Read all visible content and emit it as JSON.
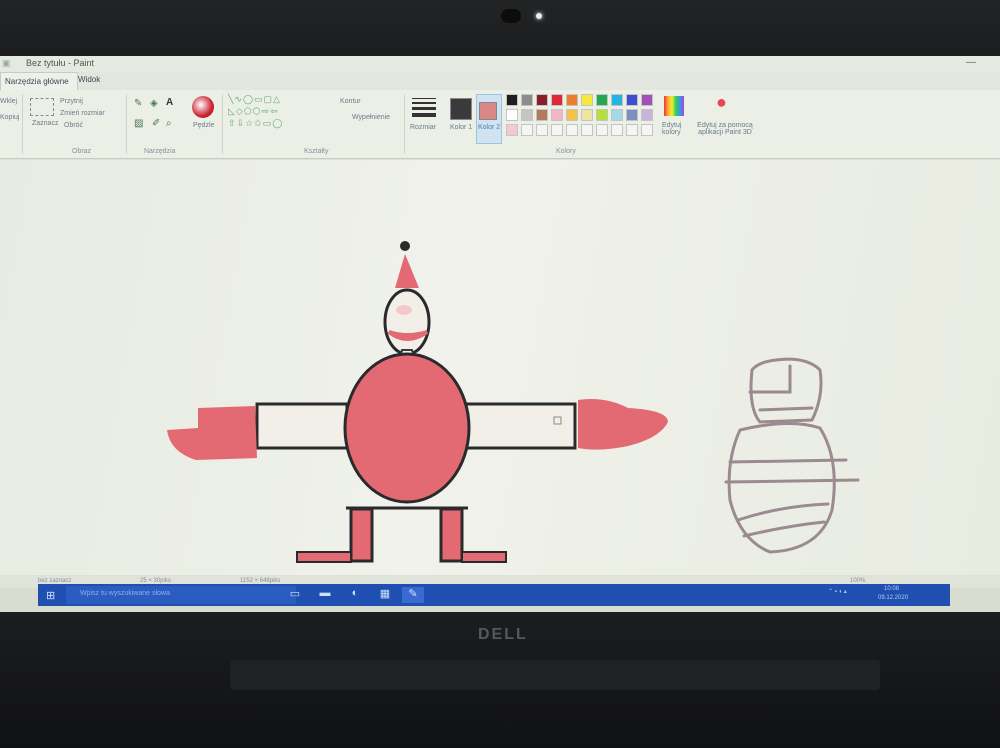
{
  "window": {
    "title": "Bez tytułu - Paint"
  },
  "tabs": [
    {
      "label": "Narzędzia główne"
    },
    {
      "label": "Widok"
    }
  ],
  "ribbon": {
    "clipboard": {
      "paste": "Wklej",
      "cut": "Wytnij",
      "copy": "Kopiuj"
    },
    "image": {
      "select": "Zaznacz",
      "crop": "Przytnij",
      "resize": "Zmień rozmiar",
      "rotate": "Obróć",
      "group": "Obraz"
    },
    "tools": {
      "group": "Narzędzia",
      "brushes": "Pędzle"
    },
    "shapes": {
      "group": "Kształty",
      "outline": "Kontur",
      "fill": "Wypełnienie"
    },
    "size": "Rozmiar",
    "colors": {
      "group": "Kolory",
      "color1": "Kolor 1",
      "color2": "Kolor 2",
      "color1_value": "#3a3a3d",
      "color2_value": "#d98686",
      "edit": "Edytuj kolory",
      "paint3d": "Edytuj za pomocą aplikacji Paint 3D",
      "palette_row1": [
        "#1f1f22",
        "#8c8c8c",
        "#8b1e2c",
        "#e0273a",
        "#ef7b2c",
        "#f7e93a",
        "#23a84f",
        "#23b4e6",
        "#3c4fd1",
        "#a24fb8"
      ],
      "palette_row2": [
        "#ffffff",
        "#c5c5c5",
        "#b37b5e",
        "#f4b4c9",
        "#f4c24a",
        "#efe4a6",
        "#b4e03a",
        "#a6d8ec",
        "#7b8fc0",
        "#c6b4dc"
      ],
      "palette_row3": [
        "#f2c9d3",
        "#f5f5f5",
        "#f5f5f5",
        "#f5f5f5",
        "#f5f5f5",
        "#f5f5f5",
        "#f5f5f5",
        "#f5f5f5",
        "#f5f5f5",
        "#f5f5f5"
      ]
    }
  },
  "status": {
    "a": "bez zaznacz",
    "b": "25 × 30piks",
    "c": "1152 × 648piks",
    "zoom": "100%"
  },
  "taskbar": {
    "search_placeholder": "Wpisz tu wyszukiwane słowa",
    "time": "10:08",
    "date": "09.12.2020"
  },
  "bezel": {
    "brand": "DELL"
  }
}
